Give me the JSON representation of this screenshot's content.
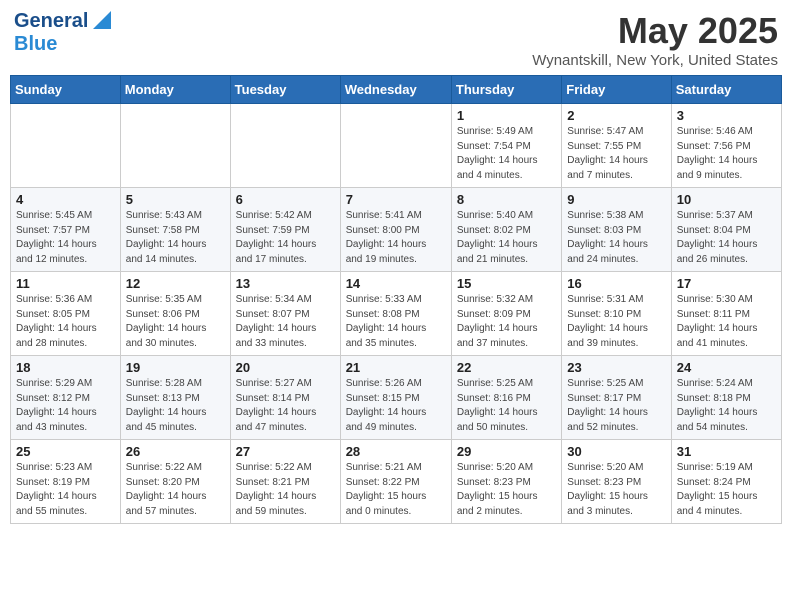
{
  "header": {
    "logo_general": "General",
    "logo_blue": "Blue",
    "month_title": "May 2025",
    "location": "Wynantskill, New York, United States"
  },
  "days_of_week": [
    "Sunday",
    "Monday",
    "Tuesday",
    "Wednesday",
    "Thursday",
    "Friday",
    "Saturday"
  ],
  "weeks": [
    [
      {
        "day": "",
        "info": ""
      },
      {
        "day": "",
        "info": ""
      },
      {
        "day": "",
        "info": ""
      },
      {
        "day": "",
        "info": ""
      },
      {
        "day": "1",
        "info": "Sunrise: 5:49 AM\nSunset: 7:54 PM\nDaylight: 14 hours\nand 4 minutes."
      },
      {
        "day": "2",
        "info": "Sunrise: 5:47 AM\nSunset: 7:55 PM\nDaylight: 14 hours\nand 7 minutes."
      },
      {
        "day": "3",
        "info": "Sunrise: 5:46 AM\nSunset: 7:56 PM\nDaylight: 14 hours\nand 9 minutes."
      }
    ],
    [
      {
        "day": "4",
        "info": "Sunrise: 5:45 AM\nSunset: 7:57 PM\nDaylight: 14 hours\nand 12 minutes."
      },
      {
        "day": "5",
        "info": "Sunrise: 5:43 AM\nSunset: 7:58 PM\nDaylight: 14 hours\nand 14 minutes."
      },
      {
        "day": "6",
        "info": "Sunrise: 5:42 AM\nSunset: 7:59 PM\nDaylight: 14 hours\nand 17 minutes."
      },
      {
        "day": "7",
        "info": "Sunrise: 5:41 AM\nSunset: 8:00 PM\nDaylight: 14 hours\nand 19 minutes."
      },
      {
        "day": "8",
        "info": "Sunrise: 5:40 AM\nSunset: 8:02 PM\nDaylight: 14 hours\nand 21 minutes."
      },
      {
        "day": "9",
        "info": "Sunrise: 5:38 AM\nSunset: 8:03 PM\nDaylight: 14 hours\nand 24 minutes."
      },
      {
        "day": "10",
        "info": "Sunrise: 5:37 AM\nSunset: 8:04 PM\nDaylight: 14 hours\nand 26 minutes."
      }
    ],
    [
      {
        "day": "11",
        "info": "Sunrise: 5:36 AM\nSunset: 8:05 PM\nDaylight: 14 hours\nand 28 minutes."
      },
      {
        "day": "12",
        "info": "Sunrise: 5:35 AM\nSunset: 8:06 PM\nDaylight: 14 hours\nand 30 minutes."
      },
      {
        "day": "13",
        "info": "Sunrise: 5:34 AM\nSunset: 8:07 PM\nDaylight: 14 hours\nand 33 minutes."
      },
      {
        "day": "14",
        "info": "Sunrise: 5:33 AM\nSunset: 8:08 PM\nDaylight: 14 hours\nand 35 minutes."
      },
      {
        "day": "15",
        "info": "Sunrise: 5:32 AM\nSunset: 8:09 PM\nDaylight: 14 hours\nand 37 minutes."
      },
      {
        "day": "16",
        "info": "Sunrise: 5:31 AM\nSunset: 8:10 PM\nDaylight: 14 hours\nand 39 minutes."
      },
      {
        "day": "17",
        "info": "Sunrise: 5:30 AM\nSunset: 8:11 PM\nDaylight: 14 hours\nand 41 minutes."
      }
    ],
    [
      {
        "day": "18",
        "info": "Sunrise: 5:29 AM\nSunset: 8:12 PM\nDaylight: 14 hours\nand 43 minutes."
      },
      {
        "day": "19",
        "info": "Sunrise: 5:28 AM\nSunset: 8:13 PM\nDaylight: 14 hours\nand 45 minutes."
      },
      {
        "day": "20",
        "info": "Sunrise: 5:27 AM\nSunset: 8:14 PM\nDaylight: 14 hours\nand 47 minutes."
      },
      {
        "day": "21",
        "info": "Sunrise: 5:26 AM\nSunset: 8:15 PM\nDaylight: 14 hours\nand 49 minutes."
      },
      {
        "day": "22",
        "info": "Sunrise: 5:25 AM\nSunset: 8:16 PM\nDaylight: 14 hours\nand 50 minutes."
      },
      {
        "day": "23",
        "info": "Sunrise: 5:25 AM\nSunset: 8:17 PM\nDaylight: 14 hours\nand 52 minutes."
      },
      {
        "day": "24",
        "info": "Sunrise: 5:24 AM\nSunset: 8:18 PM\nDaylight: 14 hours\nand 54 minutes."
      }
    ],
    [
      {
        "day": "25",
        "info": "Sunrise: 5:23 AM\nSunset: 8:19 PM\nDaylight: 14 hours\nand 55 minutes."
      },
      {
        "day": "26",
        "info": "Sunrise: 5:22 AM\nSunset: 8:20 PM\nDaylight: 14 hours\nand 57 minutes."
      },
      {
        "day": "27",
        "info": "Sunrise: 5:22 AM\nSunset: 8:21 PM\nDaylight: 14 hours\nand 59 minutes."
      },
      {
        "day": "28",
        "info": "Sunrise: 5:21 AM\nSunset: 8:22 PM\nDaylight: 15 hours\nand 0 minutes."
      },
      {
        "day": "29",
        "info": "Sunrise: 5:20 AM\nSunset: 8:23 PM\nDaylight: 15 hours\nand 2 minutes."
      },
      {
        "day": "30",
        "info": "Sunrise: 5:20 AM\nSunset: 8:23 PM\nDaylight: 15 hours\nand 3 minutes."
      },
      {
        "day": "31",
        "info": "Sunrise: 5:19 AM\nSunset: 8:24 PM\nDaylight: 15 hours\nand 4 minutes."
      }
    ]
  ]
}
